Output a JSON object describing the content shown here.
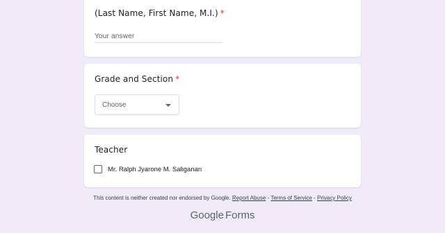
{
  "name_question": {
    "title": "(Last Name, First Name, M.I.)",
    "required_mark": "*",
    "placeholder": "Your answer"
  },
  "grade_question": {
    "title": "Grade and Section",
    "required_mark": "*",
    "dropdown_value": "Choose"
  },
  "teacher_question": {
    "title": "Teacher",
    "option_label": "Mr. Ralph Jyarone M. Saliganan",
    "option_checked": false
  },
  "footer": {
    "disclaimer": "This content is neither created nor endorsed by Google.",
    "report_abuse": "Report Abuse",
    "sep1": "-",
    "terms": "Terms of Service",
    "sep2": "-",
    "privacy": "Privacy Policy"
  },
  "brand": {
    "google": "Google",
    "forms": "Forms"
  }
}
